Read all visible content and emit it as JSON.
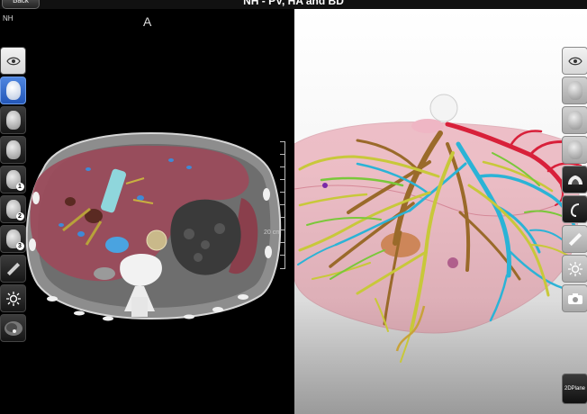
{
  "header": {
    "back_label": "Back",
    "title": "NH - PV, HA and BD"
  },
  "toolbar": {
    "buttons": [
      {
        "icon": "lightbulb-icon"
      },
      {
        "icon": "bar-chart-icon"
      },
      {
        "icon": "clapperboard-icon"
      }
    ]
  },
  "ct_view": {
    "patient_label": "NH",
    "orientation_label": "A",
    "scale_label": "20 cm"
  },
  "left_sidebar": {
    "buttons": [
      {
        "icon": "eye-icon"
      },
      {
        "icon": "head-icon",
        "active": true
      },
      {
        "icon": "head-side-icon"
      },
      {
        "icon": "head-front-icon"
      },
      {
        "icon": "head-1-icon",
        "num": "1"
      },
      {
        "icon": "head-2-icon",
        "num": "2"
      },
      {
        "icon": "head-3-icon",
        "num": "3"
      },
      {
        "icon": "ruler-icon"
      },
      {
        "icon": "brightness-icon"
      },
      {
        "icon": "ct-thumbnail-icon"
      }
    ]
  },
  "right_sidebar": {
    "buttons": [
      {
        "icon": "eye-icon"
      },
      {
        "icon": "head-icon"
      },
      {
        "icon": "head-side-icon"
      },
      {
        "icon": "head-front-icon"
      },
      {
        "icon": "anatomy-2d-icon",
        "dark": true
      },
      {
        "icon": "clip-tool-icon"
      },
      {
        "icon": "ruler-icon"
      },
      {
        "icon": "brightness-icon"
      },
      {
        "icon": "camera-icon"
      }
    ],
    "plane_button_label": "2DPlane"
  },
  "colors": {
    "liver": "#9b4a5a",
    "portal_vein": "#2bb3d6",
    "hepatic_artery": "#d8203a",
    "bile_duct": "#c8c83a",
    "hepatic_vein": "#9a6a2a",
    "active_button": "#3a74d0"
  }
}
